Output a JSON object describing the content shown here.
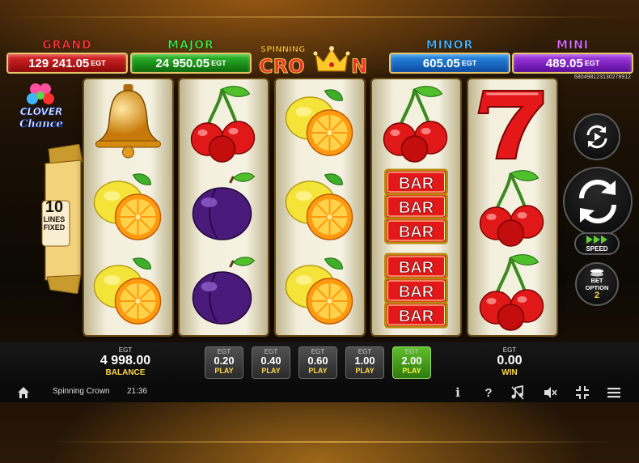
{
  "jackpots": {
    "grand": {
      "title": "GRAND",
      "value": "129 241.05",
      "currency": "EGT"
    },
    "major": {
      "title": "MAJOR",
      "value": "24 950.05",
      "currency": "EGT"
    },
    "minor": {
      "title": "MINOR",
      "value": "605.05",
      "currency": "EGT"
    },
    "mini": {
      "title": "MINI",
      "value": "489.05",
      "currency": "EGT"
    }
  },
  "logo": {
    "top": "SPINNING",
    "bottom_left": "CRO",
    "bottom_right": "N"
  },
  "game_id": "680498123130278912",
  "clover_logo": {
    "line1": "CLOVER",
    "line2": "Chance"
  },
  "lines": {
    "count": "10",
    "label_1": "LINES",
    "label_2": "FIXED"
  },
  "reels": [
    [
      "bell",
      "lemon",
      "lemon"
    ],
    [
      "cherry",
      "plum",
      "plum"
    ],
    [
      "lemon",
      "lemon",
      "lemon"
    ],
    [
      "cherry",
      "bar3",
      "bar3"
    ],
    [
      "seven",
      "cherry",
      "cherry"
    ]
  ],
  "bar_text": "BAR",
  "controls": {
    "autoplay_icon": "autoplay-icon",
    "spin_icon": "spin-arrows-icon",
    "speed_label": "SPEED",
    "bet_option_line1": "BET",
    "bet_option_line2": "OPTION",
    "bet_option_value": "2"
  },
  "balance": {
    "currency": "EGT",
    "amount": "4 998.00",
    "label": "BALANCE"
  },
  "bets": [
    {
      "currency": "EGT",
      "amount": "0.20",
      "label": "PLAY",
      "active": false
    },
    {
      "currency": "EGT",
      "amount": "0.40",
      "label": "PLAY",
      "active": false
    },
    {
      "currency": "EGT",
      "amount": "0.60",
      "label": "PLAY",
      "active": false
    },
    {
      "currency": "EGT",
      "amount": "1.00",
      "label": "PLAY",
      "active": false
    },
    {
      "currency": "EGT",
      "amount": "2.00",
      "label": "PLAY",
      "active": true
    }
  ],
  "win": {
    "currency": "EGT",
    "amount": "0.00",
    "label": "WIN"
  },
  "status_bar": {
    "game_name": "Spinning Crown",
    "time": "21:36",
    "icons": [
      "home-icon",
      "info-icon",
      "help-icon",
      "music-off-icon",
      "sound-off-icon",
      "fullscreen-icon",
      "menu-icon"
    ]
  },
  "colors": {
    "grand": "#e02828",
    "major": "#2fbd2c",
    "minor": "#2a8fe8",
    "mini": "#a83ee8",
    "gold": "#ffd84a",
    "active_bet": "#5fbf2a"
  }
}
